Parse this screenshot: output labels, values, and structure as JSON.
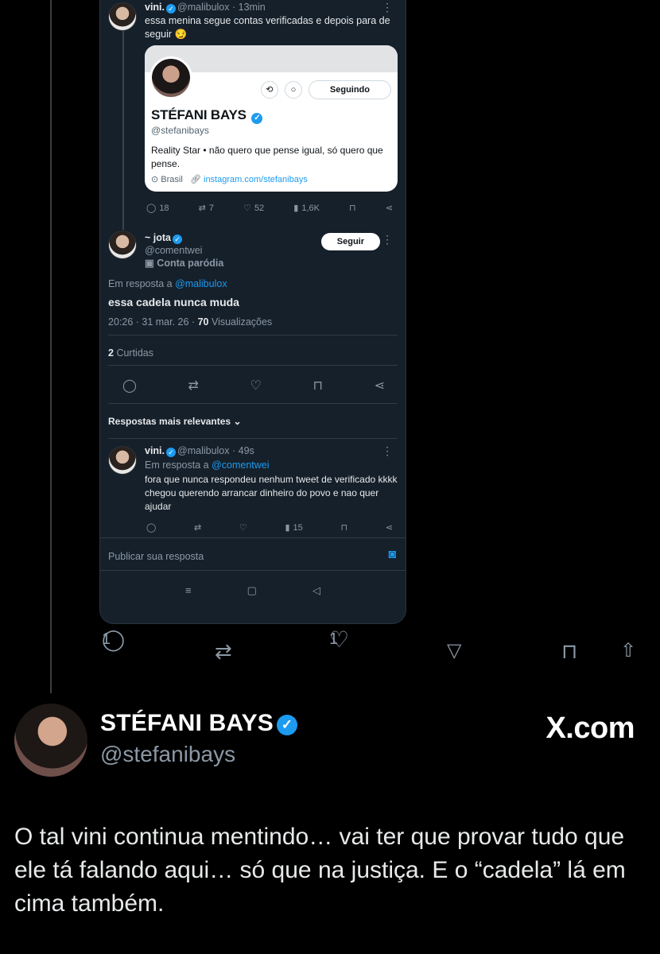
{
  "tweet1": {
    "name": "vini.",
    "handle": "@malibulox",
    "time": "· 13min",
    "text": "essa menina segue contas verificadas e depois para de seguir 😏",
    "stats": {
      "replies": "18",
      "retweets": "7",
      "likes": "52",
      "views": "1,6K"
    }
  },
  "card": {
    "name": "STÉFANI BAYS",
    "handle": "@stefanibays",
    "follow_label": "Seguindo",
    "bio": "Reality Star • não quero que pense igual, só quero que pense.",
    "location": "Brasil",
    "link": "instagram.com/stefanibays"
  },
  "tweet2": {
    "name": "~ jota",
    "handle": "@comentwei",
    "parody": "Conta paródia",
    "follow_label": "Seguir",
    "reply_to_prefix": "Em resposta a",
    "reply_to_handle": "@malibulox",
    "text": "essa cadela nunca muda",
    "timestamp": "20:26 · 31 mar. 26 ·",
    "views_count": "70",
    "views_label": "Visualizações",
    "likes_count": "2",
    "likes_label": "Curtidas"
  },
  "sort_label": "Respostas mais relevantes",
  "tweet3": {
    "name": "vini.",
    "handle": "@malibulox",
    "time": "· 49s",
    "reply_to_prefix": "Em resposta a",
    "reply_to_handle": "@comentwei",
    "text": "fora que nunca respondeu nenhum tweet de verificado kkkk chegou querendo arrancar dinheiro do povo e nao quer ajudar",
    "views": "15"
  },
  "reply_placeholder": "Publicar sua resposta",
  "outer": {
    "replies": "1",
    "likes": "1"
  },
  "author": {
    "name": "STÉFANI BAYS",
    "handle": "@stefanibays",
    "brand": "X.com",
    "text": "O tal vini continua mentindo… vai ter que provar tudo que ele tá falando aqui… só que na justiça.  E o “cadela” lá em cima também."
  },
  "colors": {
    "accent": "#1d9bf0",
    "phone_bg": "#15202b",
    "page_bg": "#000000"
  }
}
